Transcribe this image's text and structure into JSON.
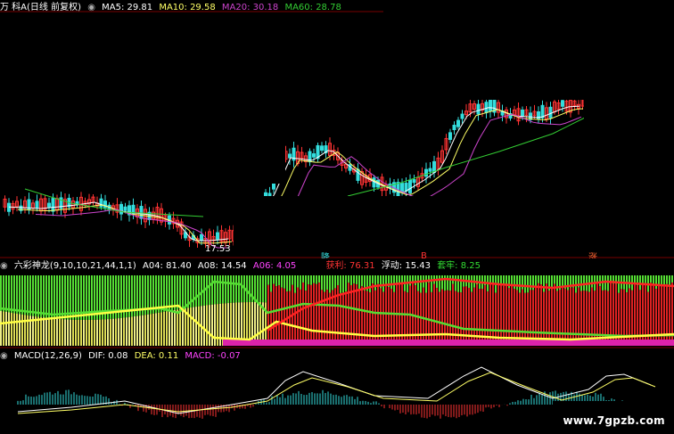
{
  "price_panel": {
    "title": "万 科A(日线 前复权)",
    "ma_labels": [
      {
        "text": "MA5: 29.81",
        "color": "#ffffff"
      },
      {
        "text": "MA10: 29.58",
        "color": "#ffff66"
      },
      {
        "text": "MA20: 30.18",
        "color": "#cc44cc"
      },
      {
        "text": "MA60: 28.78",
        "color": "#33cc33"
      }
    ],
    "low_label": "17.53",
    "marks": [
      "降",
      "B",
      "涨"
    ]
  },
  "indicator_panel": {
    "title": "六彩神龙(9,10,10,21,44,1,1)",
    "values": [
      {
        "text": "A04: 81.40",
        "color": "#ffffff"
      },
      {
        "text": "A08: 14.54",
        "color": "#ffffff"
      },
      {
        "text": "A06: 4.05",
        "color": "#ff44ff"
      },
      {
        "text": "获利: 76.31",
        "color": "#ff3333"
      },
      {
        "text": "浮动: 15.43",
        "color": "#ffffff"
      },
      {
        "text": "套牢: 8.25",
        "color": "#33dd33"
      }
    ]
  },
  "macd_panel": {
    "title": "MACD(12,26,9)",
    "values": [
      {
        "text": "DIF: 0.08",
        "color": "#ffffff"
      },
      {
        "text": "DEA: 0.11",
        "color": "#ffff66"
      },
      {
        "text": "MACD: -0.07",
        "color": "#ff44ff"
      }
    ]
  },
  "watermark": "www.7gpzb.com",
  "colors": {
    "up": "#ff3333",
    "down": "#33dddd",
    "green_area": "#55dd33",
    "red_area": "#dd2222",
    "yellow": "#ffff44"
  }
}
